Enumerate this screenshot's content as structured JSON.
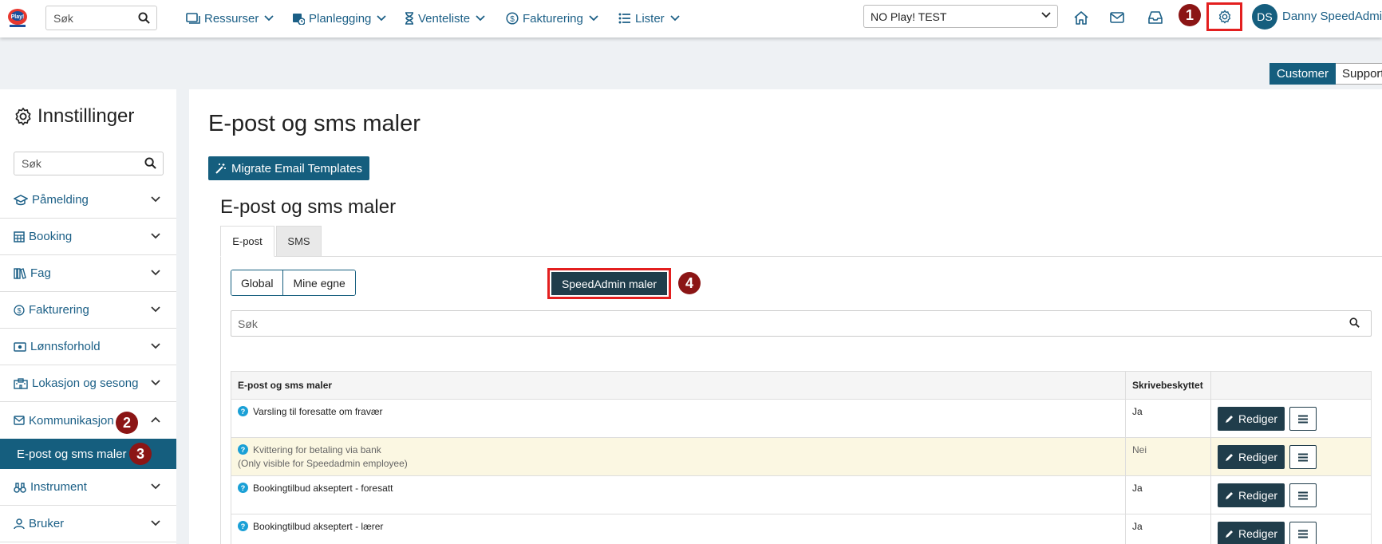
{
  "topbar": {
    "logo_icon": "play-logo",
    "search_placeholder": "Søk",
    "nav": [
      {
        "label": "Ressurser",
        "icon": "layers-icon"
      },
      {
        "label": "Planlegging",
        "icon": "calendar-clock-icon"
      },
      {
        "label": "Venteliste",
        "icon": "hourglass-icon"
      },
      {
        "label": "Fakturering",
        "icon": "dollar-circle-icon"
      },
      {
        "label": "Lister",
        "icon": "list-icon"
      }
    ],
    "school_select": "NO Play! TEST",
    "avatar_initials": "DS",
    "user_name": "Danny SpeedAdmin"
  },
  "annotations": {
    "one": "1",
    "two": "2",
    "three": "3",
    "four": "4"
  },
  "mode_toggle": {
    "customer": "Customer",
    "support": "Support"
  },
  "sidebar": {
    "title": "Innstillinger",
    "search_placeholder": "Søk",
    "items": [
      {
        "label": "Påmelding",
        "icon": "graduation-cap-icon"
      },
      {
        "label": "Booking",
        "icon": "calendar-grid-icon"
      },
      {
        "label": "Fag",
        "icon": "books-icon"
      },
      {
        "label": "Fakturering",
        "icon": "dollar-circle-icon"
      },
      {
        "label": "Lønnsforhold",
        "icon": "money-icon"
      },
      {
        "label": "Lokasjon og sesong",
        "icon": "building-icon"
      },
      {
        "label": "Kommunikasjon",
        "icon": "envelope-icon"
      },
      {
        "label": "Instrument",
        "icon": "binoculars-icon"
      },
      {
        "label": "Bruker",
        "icon": "person-icon"
      }
    ],
    "active_sub": "E-post og sms maler"
  },
  "main": {
    "page_title": "E-post og sms maler",
    "migrate_button": "Migrate Email Templates",
    "section_title": "E-post og sms maler",
    "tabs": [
      {
        "label": "E-post"
      },
      {
        "label": "SMS"
      }
    ],
    "filters": [
      "Global",
      "Mine egne"
    ],
    "speedadmin_button": "SpeedAdmin maler",
    "search_placeholder": "Søk",
    "table": {
      "headers": [
        "E-post og sms maler",
        "Skrivebeskyttet"
      ],
      "rows": [
        {
          "name": "Varsling til foresatte om fravær",
          "note": "",
          "protected": "Ja"
        },
        {
          "name": "Kvittering for betaling via bank",
          "note": "(Only visible for Speedadmin employee)",
          "protected": "Nei"
        },
        {
          "name": "Bookingtilbud akseptert - foresatt",
          "note": "",
          "protected": "Ja"
        },
        {
          "name": "Bookingtilbud akseptert - lærer",
          "note": "",
          "protected": "Ja"
        }
      ],
      "edit_label": "Rediger"
    }
  },
  "colors": {
    "primary": "#155e7e",
    "dark": "#203d4b",
    "highlight": "#e31f1f",
    "badge": "#8b1515"
  }
}
